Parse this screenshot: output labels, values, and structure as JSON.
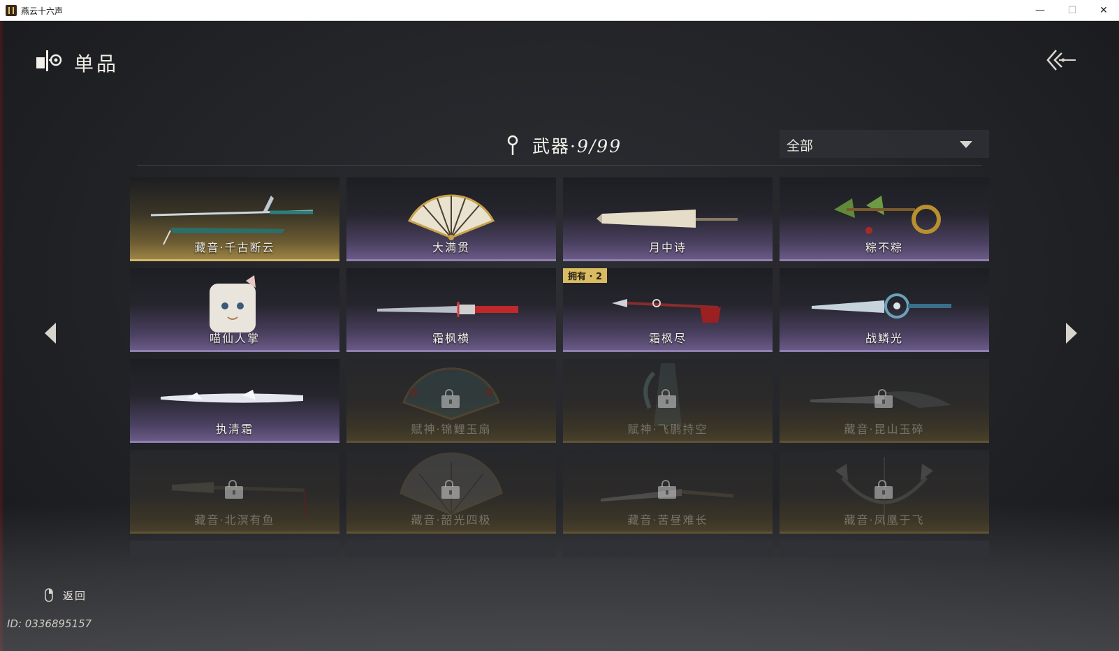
{
  "window": {
    "title": "燕云十六声"
  },
  "header": {
    "title": "单品"
  },
  "section": {
    "title": "武器·",
    "count": "9/99"
  },
  "filter": {
    "selected": "全部"
  },
  "items": [
    {
      "name": "藏音·千古断云",
      "state": "owned",
      "highlight": true
    },
    {
      "name": "大满贯",
      "state": "owned"
    },
    {
      "name": "月中诗",
      "state": "owned"
    },
    {
      "name": "粽不粽",
      "state": "owned"
    },
    {
      "name": "喵仙人掌",
      "state": "owned"
    },
    {
      "name": "霜枫横",
      "state": "owned"
    },
    {
      "name": "霜枫尽",
      "state": "owned",
      "badge": "拥有 · 2"
    },
    {
      "name": "战鳞光",
      "state": "owned"
    },
    {
      "name": "执清霜",
      "state": "owned"
    },
    {
      "name": "赋神·锦鲤玉扇",
      "state": "locked"
    },
    {
      "name": "赋神·飞鹏持空",
      "state": "locked"
    },
    {
      "name": "藏音·昆山玉碎",
      "state": "locked"
    },
    {
      "name": "藏音·北溟有鱼",
      "state": "locked"
    },
    {
      "name": "藏音·韶光四极",
      "state": "locked"
    },
    {
      "name": "藏音·苦昼难长",
      "state": "locked"
    },
    {
      "name": "藏音·凤凰于飞",
      "state": "locked"
    }
  ],
  "footer": {
    "back_label": "返回",
    "player_id": "ID: 0336895157"
  },
  "colors": {
    "owned_accent": "#8d7fb0",
    "featured_accent": "#d2b46c",
    "badge": "#d9bb62"
  }
}
